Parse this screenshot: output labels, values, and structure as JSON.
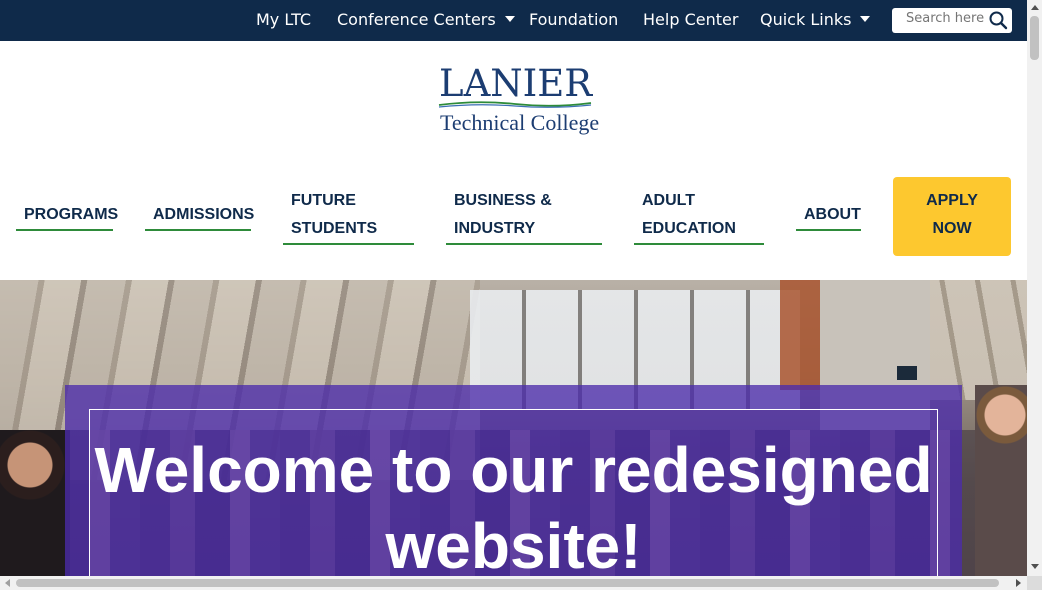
{
  "topbar": {
    "links": [
      "My LTC",
      "Conference Centers",
      "Foundation",
      "Help Center",
      "Quick Links"
    ],
    "search_placeholder": "Search here..."
  },
  "logo": {
    "line1": "LANIER",
    "line2": "Technical College"
  },
  "nav": {
    "programs": "PROGRAMS",
    "admissions": "ADMISSIONS",
    "future_students_1": "FUTURE",
    "future_students_2": "STUDENTS",
    "business_1": "BUSINESS &",
    "business_2": "INDUSTRY",
    "adult_1": "ADULT",
    "adult_2": "EDUCATION",
    "about": "ABOUT",
    "apply_1": "APPLY",
    "apply_2": "NOW"
  },
  "hero": {
    "headline": "Welcome to our redesigned website!"
  },
  "colors": {
    "topbar": "#0f2a4a",
    "accent_green": "#2e8b3a",
    "apply_yellow": "#fdc82f",
    "hero_purple": "#4c2caa"
  }
}
